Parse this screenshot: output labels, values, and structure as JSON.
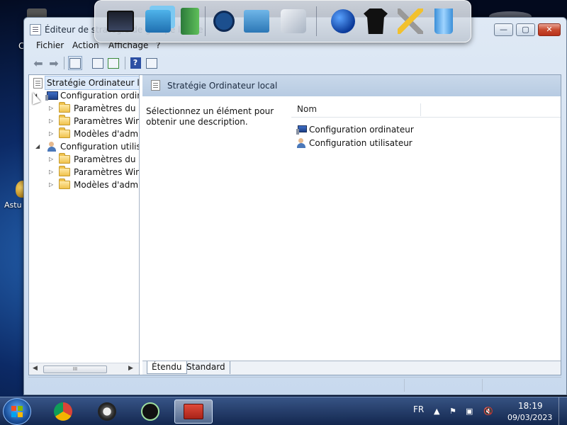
{
  "desktop": {
    "icon_label": "Astu",
    "left_letter": "C"
  },
  "window": {
    "title": "Éditeur de stratégie de groupe locale",
    "controls": {
      "minimize": "—",
      "maximize": "▢",
      "close": "✕"
    }
  },
  "menu": {
    "items": [
      "Fichier",
      "Action",
      "Affichage",
      "?"
    ]
  },
  "toolbar": {
    "back_icon": "arrow-left-icon",
    "forward_icon": "arrow-right-icon",
    "help_label": "?"
  },
  "tree": {
    "root": "Stratégie Ordinateur local",
    "nodes": [
      {
        "label": "Configuration ordinateur",
        "level": 1,
        "expanded": true
      },
      {
        "label": "Paramètres du logiciel",
        "level": 2,
        "expanded": false
      },
      {
        "label": "Paramètres Windows",
        "level": 2,
        "expanded": false
      },
      {
        "label": "Modèles d'administration",
        "level": 2,
        "expanded": false
      },
      {
        "label": "Configuration utilisateur",
        "level": 1,
        "expanded": true
      },
      {
        "label": "Paramètres du logiciel",
        "level": 2,
        "expanded": false
      },
      {
        "label": "Paramètres Windows",
        "level": 2,
        "expanded": false
      },
      {
        "label": "Modèles d'administration",
        "level": 2,
        "expanded": false
      }
    ],
    "hscroll_grip": "III"
  },
  "details": {
    "header_title": "Stratégie Ordinateur local",
    "description": "Sélectionnez un élément pour obtenir une description.",
    "column_name": "Nom",
    "items": [
      "Configuration ordinateur",
      "Configuration utilisateur"
    ]
  },
  "tabs": [
    "Étendu",
    "Standard"
  ],
  "taskbar": {
    "language": "FR",
    "time": "18:19",
    "date": "09/03/2023"
  }
}
